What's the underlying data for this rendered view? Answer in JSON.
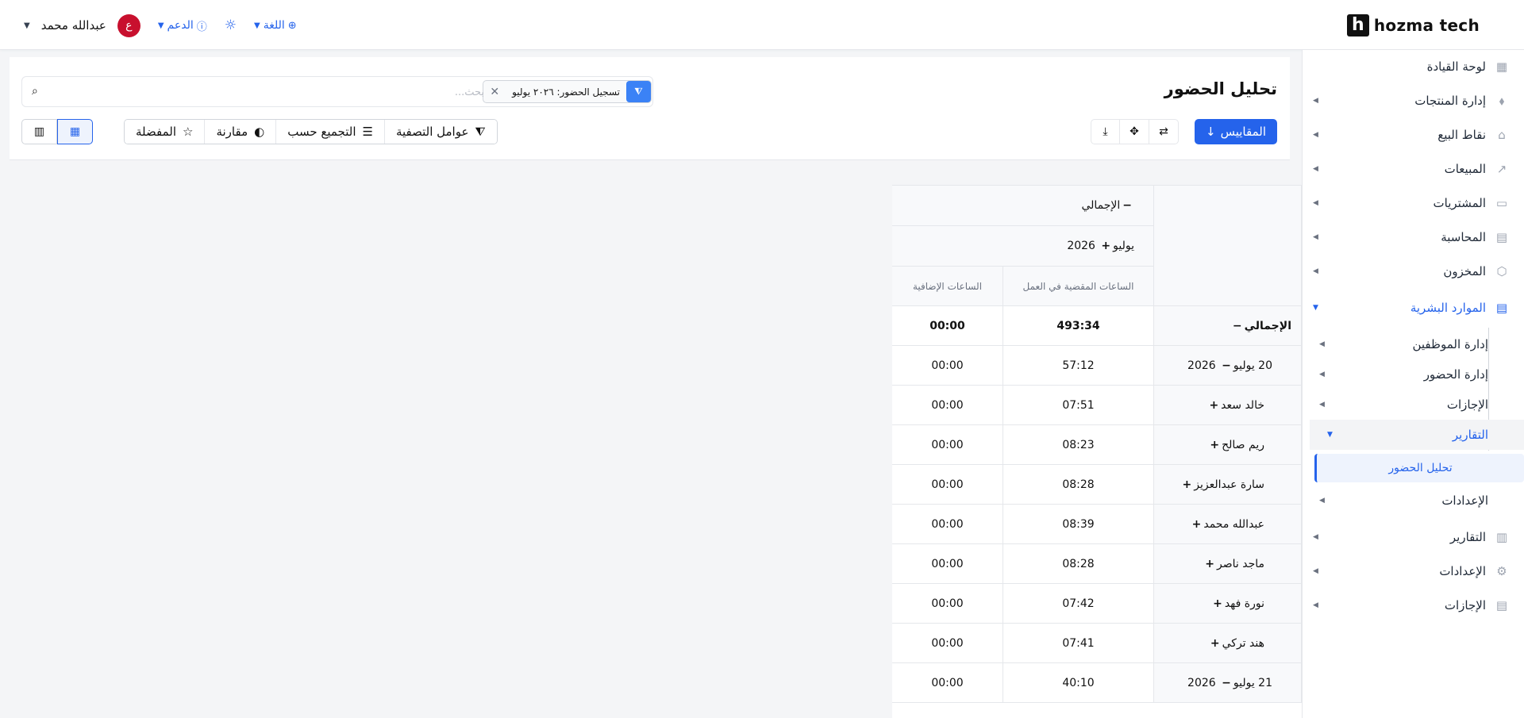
{
  "app": {
    "logo_letter": "h",
    "logo_text": "hozma tech"
  },
  "header": {
    "user_name": "عبدالله محمد",
    "avatar_letter": "ع",
    "support_label": "الدعم",
    "language_label": "اللغة",
    "icons": [
      "sun-icon",
      "globe-icon",
      "help-circle-icon"
    ]
  },
  "sidebar": {
    "items": [
      {
        "label": "لوحة القيادة",
        "icon": "dashboard-icon"
      },
      {
        "label": "إدارة المنتجات",
        "icon": "tag-icon"
      },
      {
        "label": "نقاط البيع",
        "icon": "store-icon"
      },
      {
        "label": "المبيعات",
        "icon": "chart-line-icon"
      },
      {
        "label": "المشتريات",
        "icon": "wallet-icon"
      },
      {
        "label": "المحاسبة",
        "icon": "calculator-icon"
      },
      {
        "label": "المخزون",
        "icon": "box-icon"
      },
      {
        "label": "الموارد البشرية",
        "icon": "document-icon"
      },
      {
        "label": "التقارير",
        "icon": "report-icon"
      },
      {
        "label": "الإعدادات",
        "icon": "gear-icon"
      },
      {
        "label": "الإجازات",
        "icon": "leave-icon"
      }
    ],
    "hr_submenu": [
      {
        "label": "إدارة الموظفين"
      },
      {
        "label": "إدارة الحضور"
      },
      {
        "label": "الإجازات"
      },
      {
        "label": "التقارير"
      },
      {
        "label": "الإعدادات"
      }
    ],
    "reports_leaf": "تحليل الحضور"
  },
  "page": {
    "title": "تحليل الحضور",
    "search_placeholder": "بحث...",
    "facet_text": "تسجيل الحضور: ٢٠٢٦ يوليو",
    "measures_label": "المقاييس",
    "toolbar": {
      "filters": "عوامل التصفية",
      "group_by": "التجميع حسب",
      "compare": "مقارنة",
      "favorites": "المفضلة"
    }
  },
  "pivot": {
    "col_total": "الإجمالي",
    "col_month": "يوليو",
    "col_year": "2026",
    "measures": [
      "الساعات المقضية في العمل",
      "الساعات الإضافية"
    ],
    "rows": [
      {
        "label": "الإجمالي",
        "sym": "−",
        "level": 1,
        "hours": "493:34",
        "overtime": "00:00",
        "bold": true
      },
      {
        "label": "20 يوليو",
        "year": "2026",
        "sym": "−",
        "level": 2,
        "hours": "57:12",
        "overtime": "00:00"
      },
      {
        "label": "خالد سعد",
        "sym": "+",
        "level": 3,
        "hours": "07:51",
        "overtime": "00:00"
      },
      {
        "label": "ريم صالح",
        "sym": "+",
        "level": 3,
        "hours": "08:23",
        "overtime": "00:00"
      },
      {
        "label": "سارة عبدالعزيز",
        "sym": "+",
        "level": 3,
        "hours": "08:28",
        "overtime": "00:00"
      },
      {
        "label": "عبدالله محمد",
        "sym": "+",
        "level": 3,
        "hours": "08:39",
        "overtime": "00:00"
      },
      {
        "label": "ماجد ناصر",
        "sym": "+",
        "level": 3,
        "hours": "08:28",
        "overtime": "00:00"
      },
      {
        "label": "نورة فهد",
        "sym": "+",
        "level": 3,
        "hours": "07:42",
        "overtime": "00:00"
      },
      {
        "label": "هند تركي",
        "sym": "+",
        "level": 3,
        "hours": "07:41",
        "overtime": "00:00"
      },
      {
        "label": "21 يوليو",
        "year": "2026",
        "sym": "−",
        "level": 2,
        "hours": "40:10",
        "overtime": "00:00"
      }
    ]
  },
  "colors": {
    "accent": "#2563eb",
    "avatar_bg": "#c8102e"
  }
}
